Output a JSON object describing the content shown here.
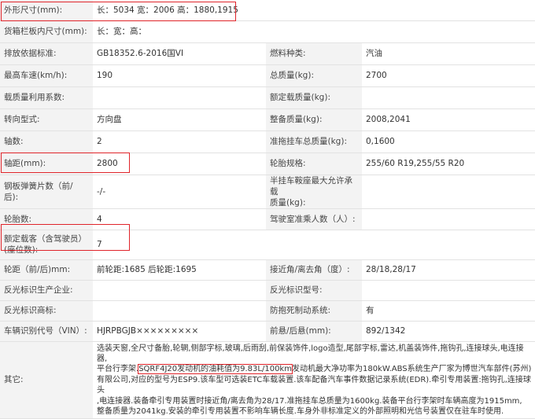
{
  "rows": [
    {
      "l1": "外形尺寸(mm):",
      "v1": "长：5034 宽：2006 高：1880,1915",
      "l2": "",
      "v2": ""
    },
    {
      "l1": "货箱栏板内尺寸(mm):",
      "v1": "长：宽：高：",
      "l2": "",
      "v2": ""
    },
    {
      "l1": "排放依据标准:",
      "v1": "GB18352.6-2016国VI",
      "l2": "燃料种类:",
      "v2": "汽油"
    },
    {
      "l1": "最高车速(km/h):",
      "v1": "190",
      "l2": "总质量(kg):",
      "v2": "2700"
    },
    {
      "l1": "载质量利用系数:",
      "v1": "",
      "l2": "额定载质量(kg):",
      "v2": ""
    },
    {
      "l1": "转向型式:",
      "v1": "方向盘",
      "l2": "整备质量(kg):",
      "v2": "2008,2041"
    },
    {
      "l1": "轴数:",
      "v1": "2",
      "l2": "准拖挂车总质量(kg):",
      "v2": "0,1600"
    },
    {
      "l1": "轴距(mm):",
      "v1": "2800",
      "l2": "轮胎规格:",
      "v2": "255/60 R19,255/55 R20"
    },
    {
      "l1a": "钢板弹簧片数（前/",
      "l1b": "后):",
      "v1": "-/-",
      "l2a": "半挂车鞍座最大允许承载",
      "l2b": "质量(kg):",
      "v2": ""
    },
    {
      "l1": "轮胎数:",
      "v1": "4",
      "l2": "驾驶室准乘人数（人）:",
      "v2": ""
    },
    {
      "l1a": "额定载客（含驾驶员）",
      "l1b": "(座位数):",
      "v1": "7",
      "l2": "",
      "v2": ""
    },
    {
      "l1": "轮距（前/后)mm:",
      "v1": "前轮距:1685 后轮距:1695",
      "l2": "接近角/离去角（度）:",
      "v2": "28/18,28/17"
    },
    {
      "l1": "反光标识生产企业:",
      "v1": "",
      "l2": "反光标识型号:",
      "v2": ""
    },
    {
      "l1": "反光标识商标:",
      "v1": "",
      "l2": "防抱死制动系统:",
      "v2": "有"
    },
    {
      "l1": "车辆识别代号（VIN）:",
      "v1": "HJRPBGJB×××××××××",
      "l2": "前悬/后悬(mm):",
      "v2": "892/1342"
    }
  ],
  "other": {
    "label": "其它:",
    "line1": "选装天窗,全尺寸备胎,轮辋,侧部字标,玻璃,后雨刮,前保装饰件,logo造型,尾部字标,雷达,机盖装饰件,拖钩孔,连接球头,电连接器,",
    "line2_pre": "平台行李架.",
    "line2_hl": "SQRF4J20发动机的油耗值为9.83L/100km",
    "line2_post": "发动机最大净功率为180kW.ABS系统生产厂家为博世汽车部件(苏州)",
    "line3": "有限公司,对应的型号为ESP9.该车型可选装ETC车载装置.该车配备汽车事件数据记录系统(EDR).牵引专用装置:拖钩孔,连接球头",
    "line4": ",电连接器.装备牵引专用装置时接近角/离去角为28/17.准拖挂车总质量为1600kg.装备平台行李架时车辆高度为1915mm,",
    "line5": "整备质量为2041kg.安装的牵引专用装置不影响车辆长度.车身外非标准定义的外部照明和光信号装置仅在驻车时使用."
  },
  "accent_color": "#e0242a"
}
